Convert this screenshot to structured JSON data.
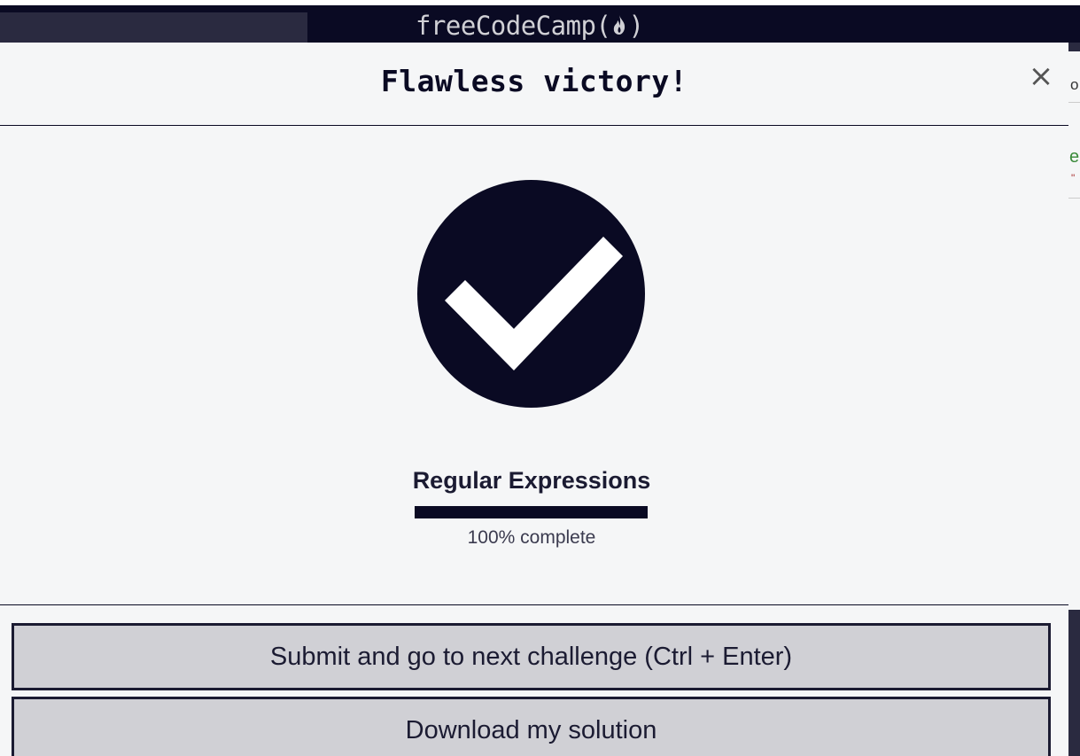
{
  "nav": {
    "brand_text": "freeCodeCamp(",
    "brand_close": ")",
    "flame_icon": "flame-icon"
  },
  "behind": {
    "t1": "o",
    "t2": "e",
    "t3": "\""
  },
  "modal": {
    "title": "Flawless victory!",
    "close_label": "×",
    "check_icon": "checkmark-circle-icon",
    "block_title": "Regular Expressions",
    "progress_percent": 100,
    "progress_text": "100% complete",
    "submit_label": "Submit and go to next challenge (Ctrl + Enter)",
    "download_label": "Download my solution"
  },
  "colors": {
    "primary_dark": "#0a0a23",
    "modal_bg": "#f5f6f7",
    "button_bg": "#d0d0d5"
  }
}
